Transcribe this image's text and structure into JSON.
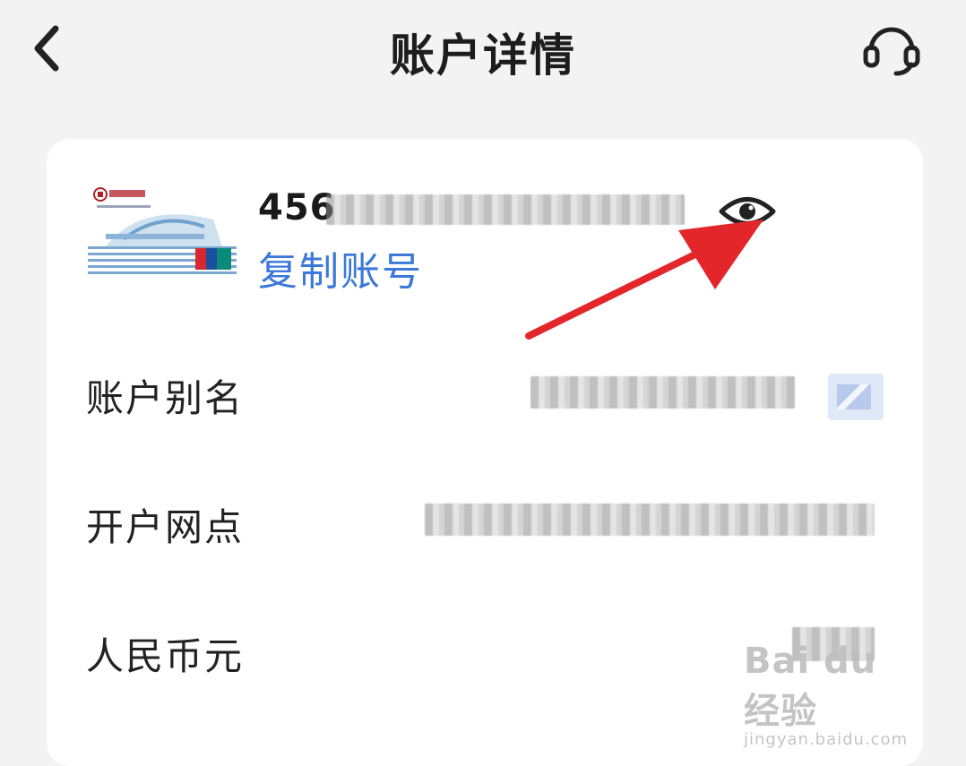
{
  "header": {
    "title": "账户详情"
  },
  "account": {
    "number_visible_prefix": "456",
    "copy_label": "复制账号"
  },
  "details": {
    "alias_label": "账户别名",
    "branch_label": "开户网点",
    "currency_label": "人民币元"
  },
  "watermark": {
    "brand": "Bai du 经验",
    "url": "jingyan.baidu.com"
  },
  "colors": {
    "accent": "#3b78d8",
    "annotation_arrow": "#e3262a"
  }
}
